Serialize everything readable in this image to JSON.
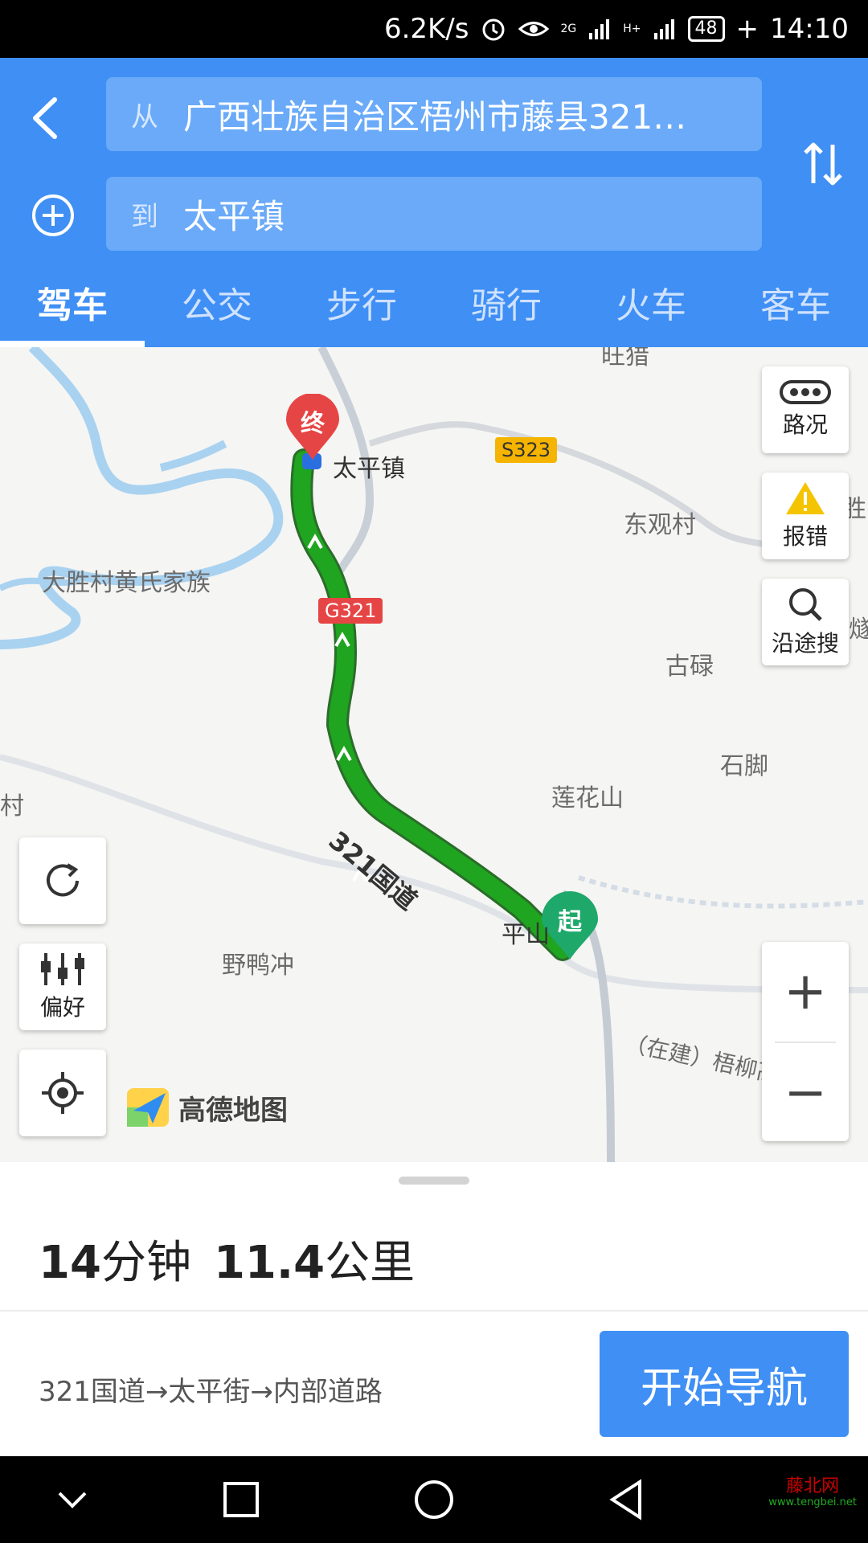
{
  "status_bar": {
    "speed": "6.2K/s",
    "signal_2g": "2G",
    "signal_h": "H+",
    "battery": "48",
    "time": "14:10"
  },
  "route": {
    "from_prefix": "从",
    "from_value": "广西壮族自治区梧州市藤县321…",
    "to_prefix": "到",
    "to_value": "太平镇"
  },
  "tabs": [
    {
      "label": "驾车",
      "active": true
    },
    {
      "label": "公交"
    },
    {
      "label": "步行"
    },
    {
      "label": "骑行"
    },
    {
      "label": "火车"
    },
    {
      "label": "客车"
    }
  ],
  "map": {
    "labels": {
      "wangcuo": "旺猎",
      "taiping": "太平镇",
      "dongguan": "东观村",
      "dasheng": "大胜村黄氏家族",
      "gulu": "古碌",
      "shijiao": "石脚",
      "lianhua": "莲花山",
      "yeyachong": "野鸭冲",
      "cun": "村",
      "sheng": "胜",
      "yan": "燧",
      "ping": "平山",
      "expressway": "（在建）梧柳高速",
      "route_road": "321国道"
    },
    "badges": {
      "s323": "S323",
      "g321": "G321"
    },
    "markers": {
      "end": "终",
      "start": "起"
    },
    "buttons": {
      "traffic": "路况",
      "report": "报错",
      "along": "沿途搜",
      "pref": "偏好"
    },
    "zoom": {
      "in": "+",
      "out": "−"
    },
    "logo": "高德地图"
  },
  "summary": {
    "time_num": "14",
    "time_unit": "分钟",
    "dist_num": "11.4",
    "dist_unit": "公里",
    "via": "321国道→太平街→内部道路",
    "start_nav": "开始导航"
  },
  "watermark": {
    "name": "藤北网",
    "url": "www.tengbei.net"
  },
  "colors": {
    "primary": "#3f8ff5",
    "route": "#1fa51f",
    "start_marker": "#1ea86a",
    "end_marker": "#e64545"
  }
}
